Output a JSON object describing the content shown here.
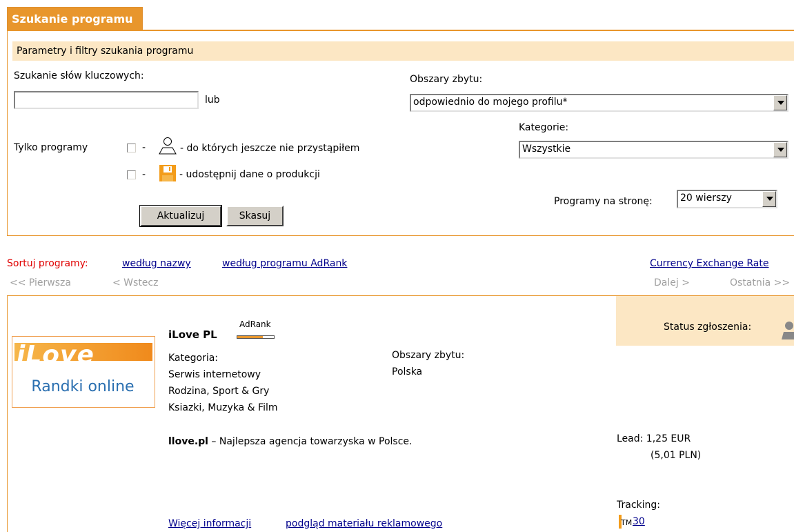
{
  "header": {
    "tab_title": "Szukanie programu",
    "subheader": "Parametry i filtry szukania programu"
  },
  "search": {
    "keywords_label": "Szukanie słów kluczowych:",
    "keywords_value": "",
    "or_label": "lub",
    "areas_label": "Obszary zbytu:",
    "areas_selected": "odpowiednio do mojego profilu*",
    "category_label": "Kategorie:",
    "category_selected": "Wszystkie",
    "only_programs_label": "Tylko programy",
    "filter1_dash": "-",
    "filter1_text": "- do których jeszcze nie przystąpiłem",
    "filter2_dash": "-",
    "filter2_text": "- udostępnij dane o produkcji",
    "per_page_label": "Programy na stronę:",
    "per_page_selected": "20 wierszy",
    "update_button": "Aktualizuj",
    "reset_button": "Skasuj"
  },
  "sort": {
    "label": "Sortuj programy:",
    "by_name": "według nazwy",
    "by_adrank": "według programu AdRank",
    "currency_link": "Currency Exchange Rate"
  },
  "pager": {
    "first": "<< Pierwsza",
    "prev": "< Wstecz",
    "next": "Dalej >",
    "last": "Ostatnia >>"
  },
  "program": {
    "logo_main": "iLove",
    "logo_sub": "Randki online",
    "name": "iLove PL",
    "adrank_label": "AdRank",
    "adrank_level": 0.7,
    "category_label": "Kategoria:",
    "categories": [
      "Serwis internetowy",
      "Rodzina, Sport & Gry",
      "Ksiazki, Muzyka & Film"
    ],
    "areas_label": "Obszary zbytu:",
    "areas_value": "Polska",
    "status_label": "Status zgłoszenia:",
    "site": "llove.pl",
    "description": " – Najlepsza agencja towarzyska w Polsce.",
    "lead": "Lead: 1,25 EUR",
    "lead_pln": "(5,01 PLN)",
    "tracking_label": "Tracking:",
    "tracking_tm": "TM",
    "tracking_days": "30",
    "more_info_link": "Więcej informacji",
    "preview_link": "podgląd materiału reklamowego"
  },
  "colors": {
    "accent": "#e8962c",
    "light_accent": "#fce7c4",
    "link": "#00008b",
    "sort_label": "#e00000"
  }
}
